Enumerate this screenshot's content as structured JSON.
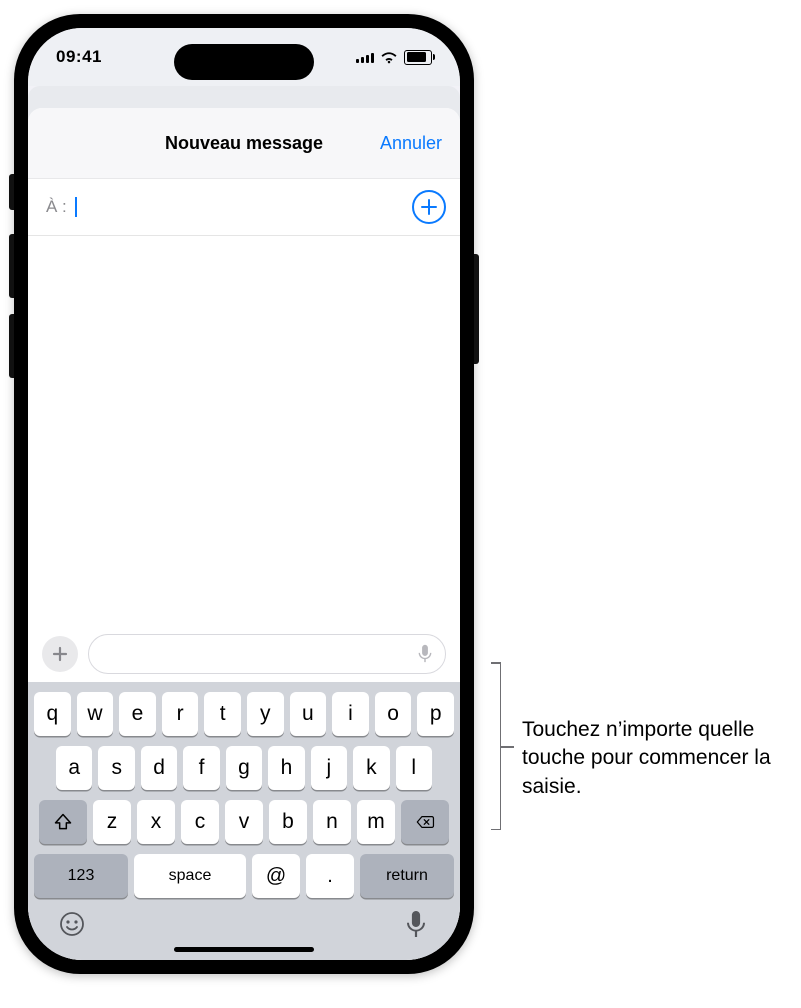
{
  "status": {
    "time": "09:41"
  },
  "sheet": {
    "title": "Nouveau message",
    "cancel": "Annuler"
  },
  "to": {
    "label": "À :"
  },
  "keyboard": {
    "row1": [
      "q",
      "w",
      "e",
      "r",
      "t",
      "y",
      "u",
      "i",
      "o",
      "p"
    ],
    "row2": [
      "a",
      "s",
      "d",
      "f",
      "g",
      "h",
      "j",
      "k",
      "l"
    ],
    "row3": [
      "z",
      "x",
      "c",
      "v",
      "b",
      "n",
      "m"
    ],
    "k123": "123",
    "space": "space",
    "at": "@",
    "dot": ".",
    "ret": "return"
  },
  "callout": {
    "text": "Touchez n’importe quelle touche pour commencer la saisie."
  }
}
